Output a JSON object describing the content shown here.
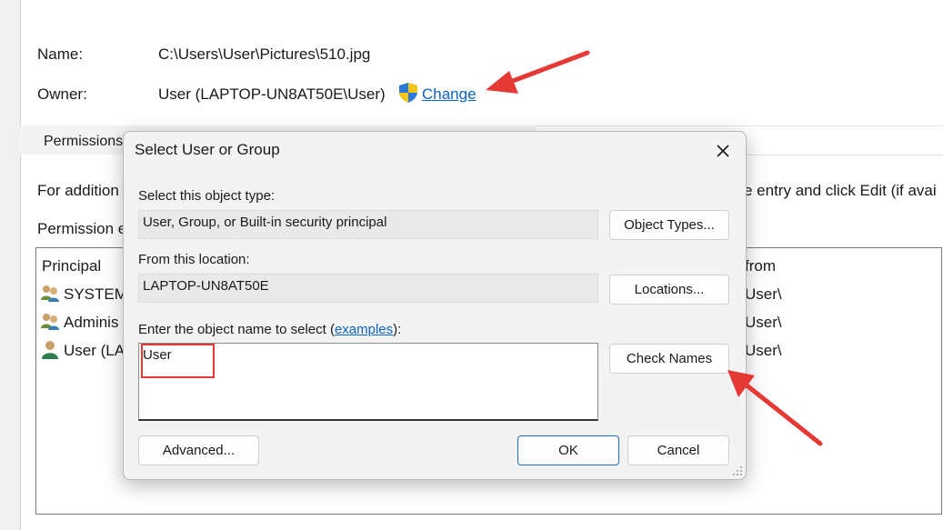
{
  "background": {
    "name_label": "Name:",
    "name_value": "C:\\Users\\User\\Pictures\\510.jpg",
    "owner_label": "Owner:",
    "owner_value": "User (LAPTOP-UN8AT50E\\User)",
    "change_link": "Change",
    "tab_permissions": "Permissions",
    "info_text_left": "For addition",
    "info_text_right": "e entry and click Edit (if avai",
    "entries_label": "Permission e",
    "list": {
      "col_principal": "Principal",
      "col_from": "from",
      "rows": [
        {
          "principal": "SYSTEM",
          "from": "User\\"
        },
        {
          "principal": "Adminis",
          "from": "User\\"
        },
        {
          "principal": "User (LA",
          "from": "User\\"
        }
      ]
    }
  },
  "dialog": {
    "title": "Select User or Group",
    "object_type_label": "Select this object type:",
    "object_type_value": "User, Group, or Built-in security principal",
    "object_types_button": "Object Types...",
    "location_label": "From this location:",
    "location_value": "LAPTOP-UN8AT50E",
    "locations_button": "Locations...",
    "enter_label_prefix": "Enter the object name to select (",
    "examples_link": "examples",
    "enter_label_suffix": "):",
    "object_name_value": "User",
    "check_names_button": "Check Names",
    "advanced_button": "Advanced...",
    "ok_button": "OK",
    "cancel_button": "Cancel"
  },
  "colors": {
    "link": "#0a64c8",
    "annotation_red": "#e53935",
    "primary_border": "#1a6fc4"
  },
  "icons": {
    "shield": "uac-shield-icon",
    "user": "user-icon",
    "group": "user-group-icon",
    "close": "close-icon"
  }
}
